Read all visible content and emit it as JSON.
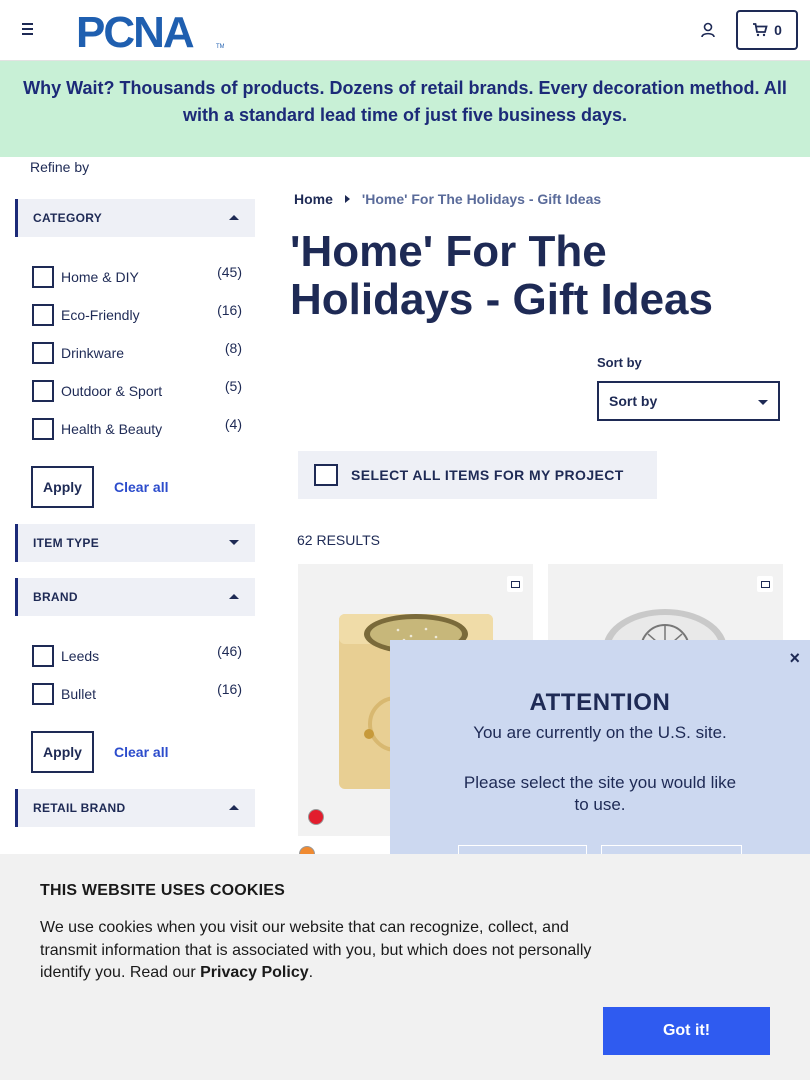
{
  "header": {
    "logo_text": "PCNA",
    "cart_count": "0"
  },
  "promo": {
    "text": "Why Wait? Thousands of products. Dozens of retail brands. Every decoration method. All with a standard lead time of just five business days."
  },
  "sidebar": {
    "refine_label": "Refine by",
    "category": {
      "title": "CATEGORY",
      "options": [
        {
          "label": "Home & DIY",
          "count": "(45)"
        },
        {
          "label": "Eco-Friendly",
          "count": "(16)"
        },
        {
          "label": "Drinkware",
          "count": "(8)"
        },
        {
          "label": "Outdoor & Sport",
          "count": "(5)"
        },
        {
          "label": "Health & Beauty",
          "count": "(4)"
        }
      ],
      "apply_label": "Apply",
      "clear_label": "Clear all"
    },
    "item_type": {
      "title": "ITEM TYPE"
    },
    "brand": {
      "title": "BRAND",
      "options": [
        {
          "label": "Leeds",
          "count": "(46)"
        },
        {
          "label": "Bullet",
          "count": "(16)"
        }
      ],
      "apply_label": "Apply",
      "clear_label": "Clear all"
    },
    "retail_brand": {
      "title": "RETAIL BRAND"
    }
  },
  "main": {
    "breadcrumb_home": "Home",
    "breadcrumb_current": "'Home' For The Holidays - Gift Ideas",
    "page_title": "'Home' For The Holidays - Gift Ideas",
    "sort_label": "Sort by",
    "sort_value": "Sort by",
    "select_all_label": "SELECT ALL ITEMS FOR MY PROJECT",
    "results_count": "62 RESULTS"
  },
  "attention_modal": {
    "close": "×",
    "title": "ATTENTION",
    "message1": "You are currently on the U.S. site.",
    "message2": "Please select the site you would like to use."
  },
  "cookie_banner": {
    "title": "THIS WEBSITE USES COOKIES",
    "body": "We use cookies when you visit our website that can recognize, collect, and transmit information that is associated with you, but which does not personally identify you. Read our ",
    "link": "Privacy Policy",
    "suffix": ".",
    "button": "Got it!"
  },
  "colors": {
    "navy": "#1e2a55",
    "promo_bg": "#c8f0d6",
    "link_blue": "#2c4ccc",
    "cookie_button": "#2f5bf0",
    "modal_bg": "#ccd8f0"
  }
}
